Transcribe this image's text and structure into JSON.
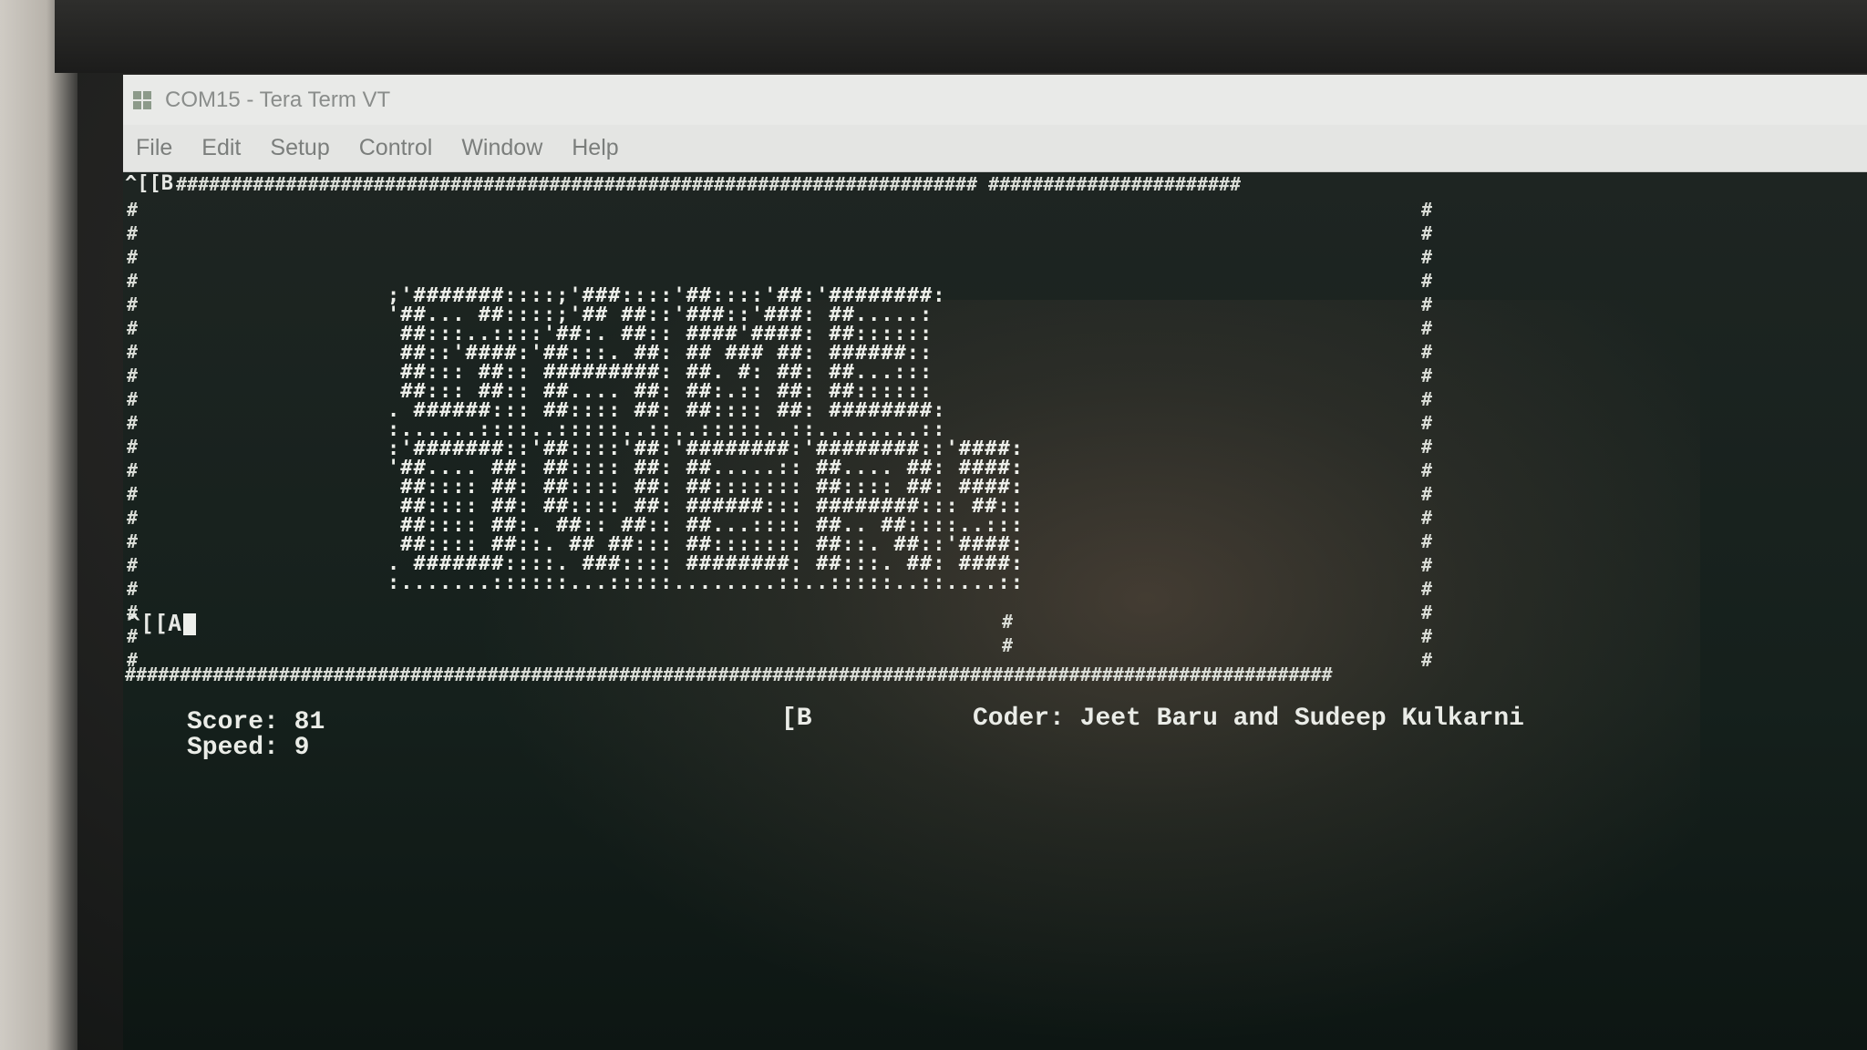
{
  "window": {
    "title": "COM15 - Tera Term VT"
  },
  "menu": [
    "File",
    "Edit",
    "Setup",
    "Control",
    "Window",
    "Help"
  ],
  "terminal": {
    "top_escape": "^[[B",
    "top_border": "######################################################################### #######################",
    "bottom_border": "##############################################################################################################",
    "side_char": "#",
    "logo_lines": [
      ";'#######::::;'###::::'##::::'##:'########:",
      "'##... ##::::;'## ##::'###::'###: ##.....:",
      " ##:::..::::'##:. ##:: ####'####: ##::::::",
      " ##::'####:'##:::. ##: ## ### ##: ######::",
      " ##::: ##:: #########: ##. #: ##: ##...:::",
      " ##::: ##:: ##.... ##: ##:.:: ##: ##::::::",
      ". ######::: ##:::: ##: ##:::: ##: ########:",
      ":......::::..:::::..::..:::::..::........::",
      ":'#######::'##::::'##:'########:'########::'####:",
      "'##.... ##: ##:::: ##: ##.....:: ##.... ##: ####:",
      " ##:::: ##: ##:::: ##: ##::::::: ##:::: ##: ####:",
      " ##:::: ##: ##:::: ##: ######::: ########::: ##::",
      " ##:::: ##:. ##:: ##:: ##...:::: ##.. ##::::..:::",
      " ##:::: ##::. ## ##::: ##::::::: ##::. ##::'####:",
      ". #######::::. ###:::: ########: ##:::. ##: ####:",
      ":.......::::::...:::::........::..:::::..::....::"
    ],
    "bottom_escape": "^[[A",
    "mid_escape": "[B"
  },
  "status": {
    "score_label": "Score:",
    "score_value": "81",
    "speed_label": "Speed:",
    "speed_value": "9",
    "coder_label": "Coder:",
    "coder_names": "Jeet Baru and Sudeep Kulkarni"
  }
}
